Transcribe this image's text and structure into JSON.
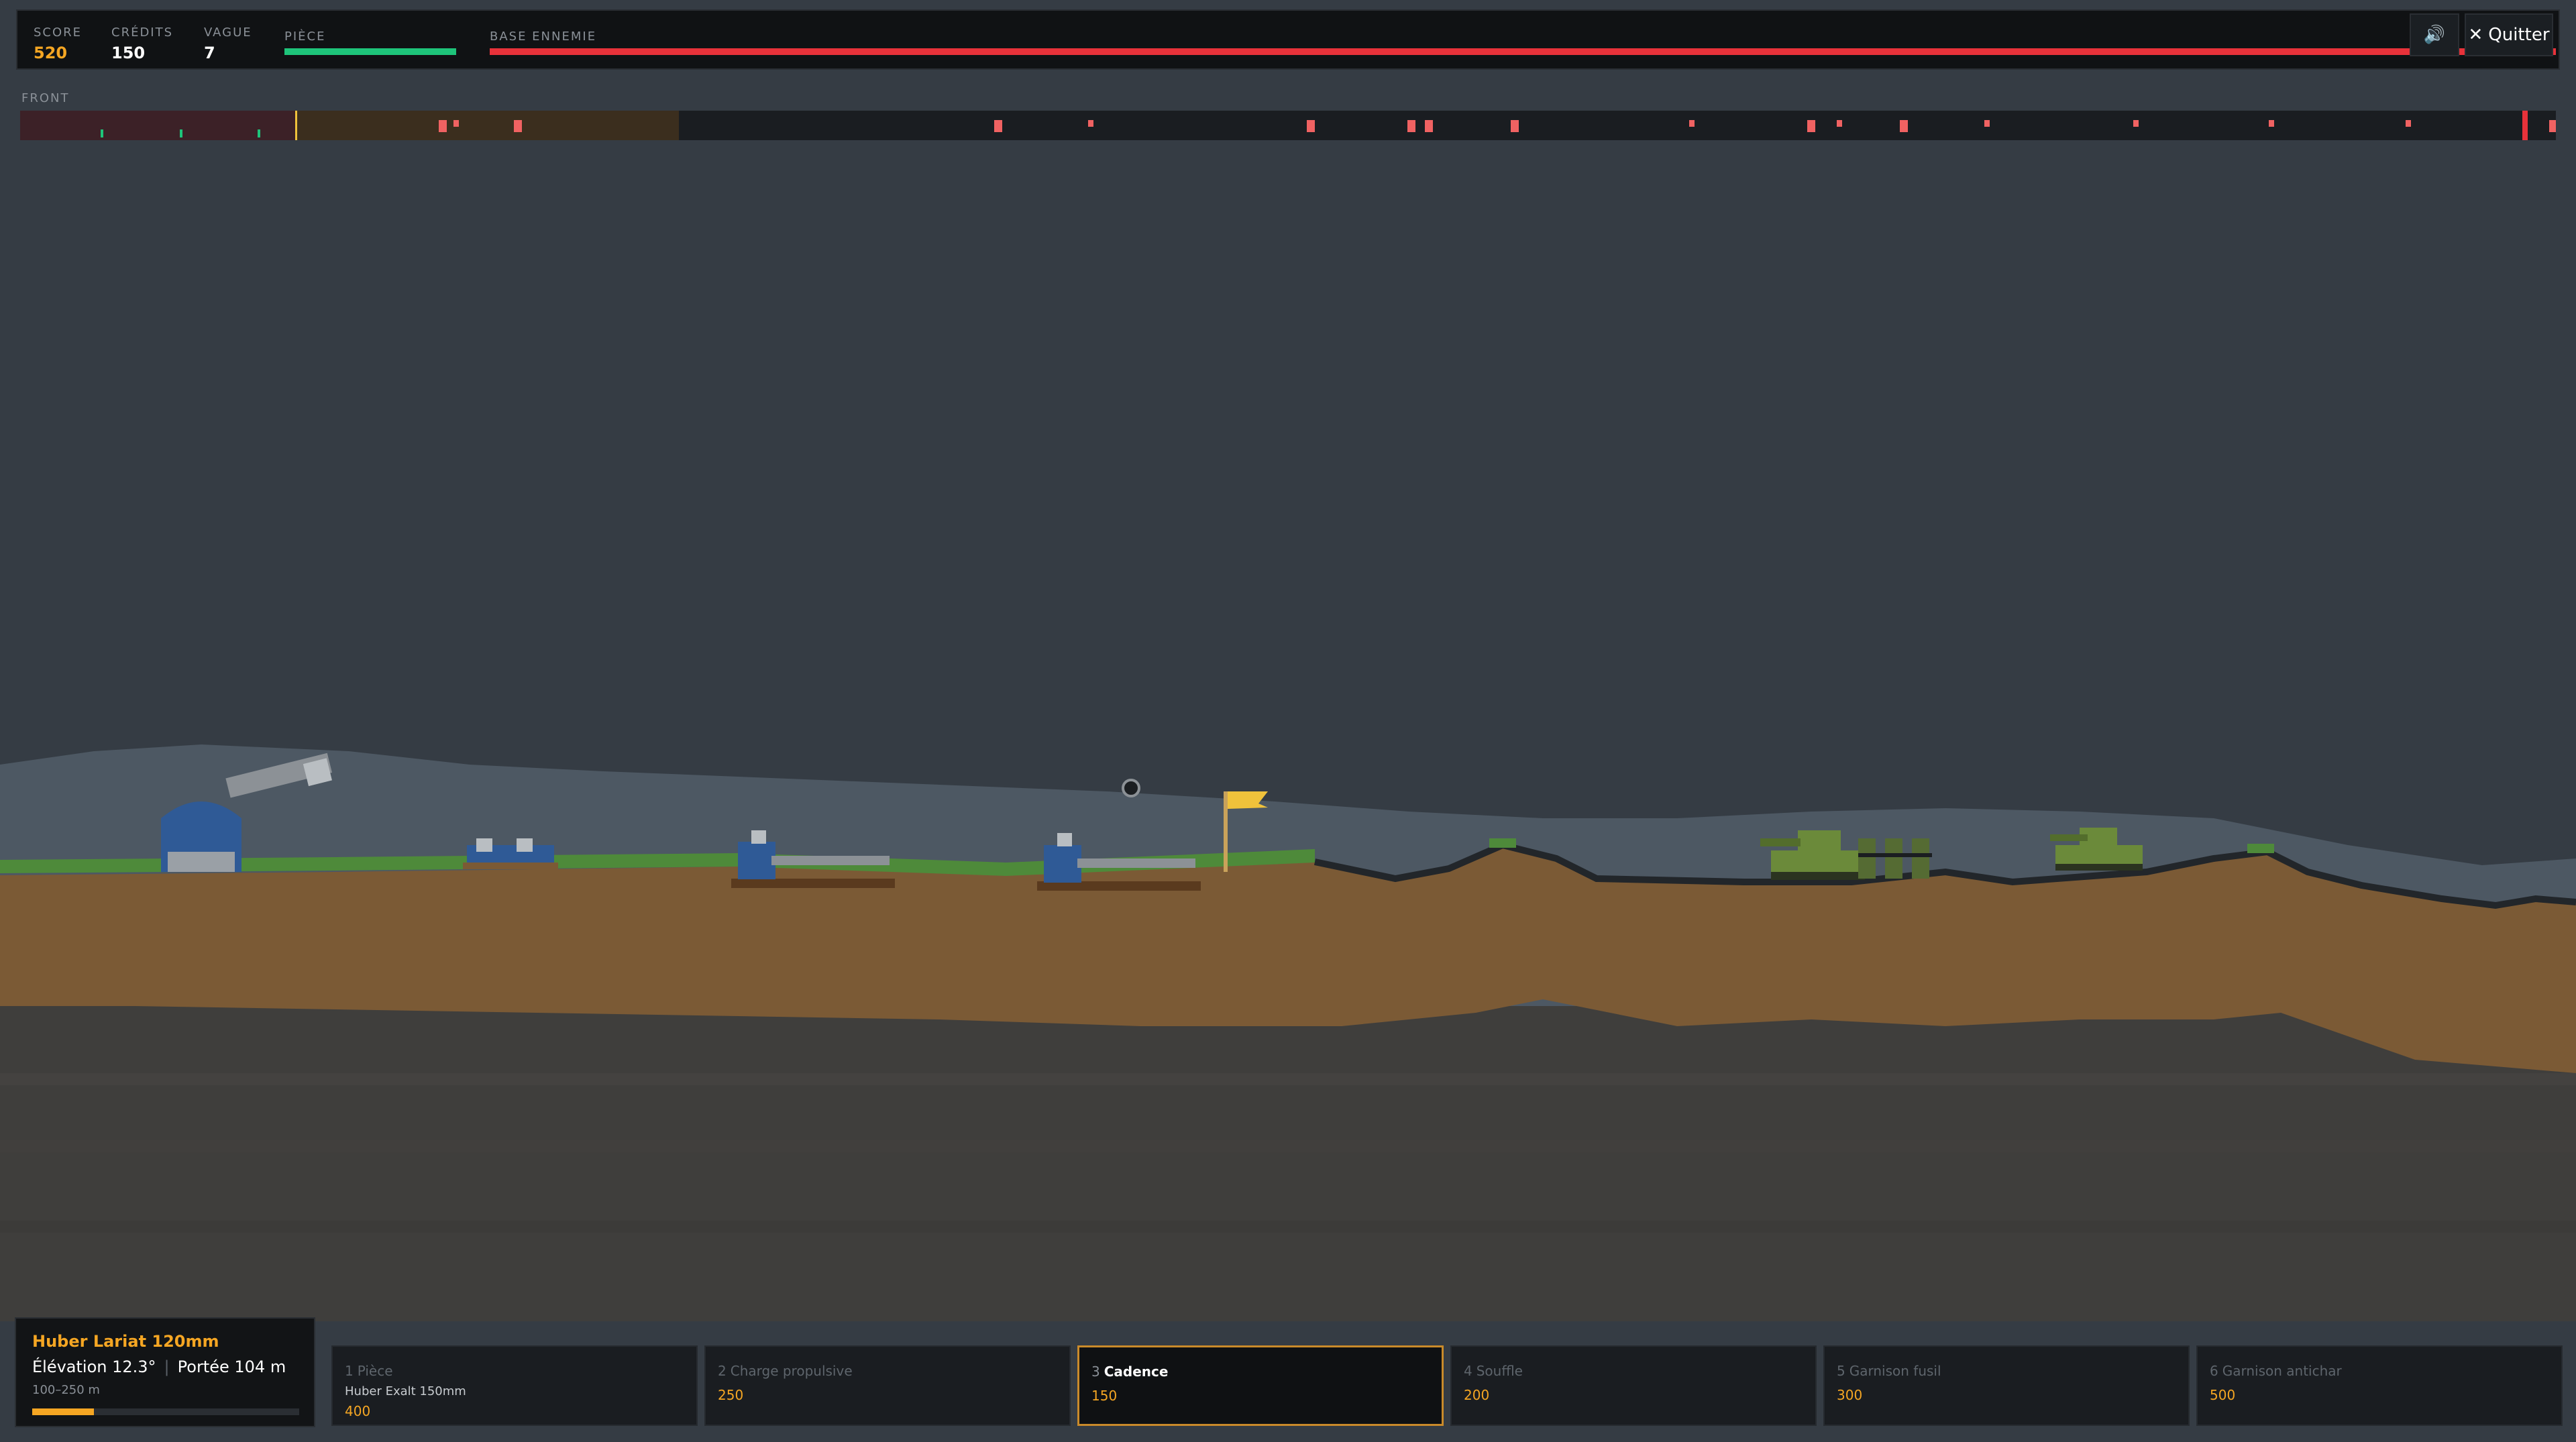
{
  "hud": {
    "score_label": "SCORE",
    "score": "520",
    "credits_label": "CRÉDITS",
    "credits": "150",
    "wave_label": "VAGUE",
    "wave": "7",
    "piece_label": "PIÈCE",
    "piece_hp": 1.0,
    "base_label": "BASE ENNEMIE",
    "base_hp": 1.0,
    "quit_label": "Quitter"
  },
  "icons": {
    "sound": "speaker-icon",
    "quit": "close-icon"
  },
  "front": {
    "label": "FRONT"
  },
  "gun": {
    "name": "Huber Lariat 120mm",
    "elevation": "Élévation 12.3°",
    "range": "Portée 104 m",
    "range_limits": "100–250 m",
    "reload": 0.23
  },
  "shop": [
    {
      "num": "1",
      "label": "Pièce",
      "sub": "Huber Exalt 150mm",
      "price": "400",
      "selected": false
    },
    {
      "num": "2",
      "label": "Charge propulsive",
      "sub": "",
      "price": "250",
      "selected": false
    },
    {
      "num": "3",
      "label": "Cadence",
      "sub": "",
      "price": "150",
      "selected": true
    },
    {
      "num": "4",
      "label": "Souffle",
      "sub": "",
      "price": "200",
      "selected": false
    },
    {
      "num": "5",
      "label": "Garnison fusil",
      "sub": "",
      "price": "300",
      "selected": false
    },
    {
      "num": "6",
      "label": "Garnison antichar",
      "sub": "",
      "price": "500",
      "selected": false
    }
  ],
  "colors": {
    "score": "#f5a623",
    "friendly_hp": "#1ec47a",
    "enemy_hp": "#e8323a",
    "sky": "#353c44",
    "dirt": "#7b5a35",
    "grass": "#4e8a3a",
    "enemy_unit": "#6b8a3a",
    "ally_unit": "#2f5a96"
  }
}
